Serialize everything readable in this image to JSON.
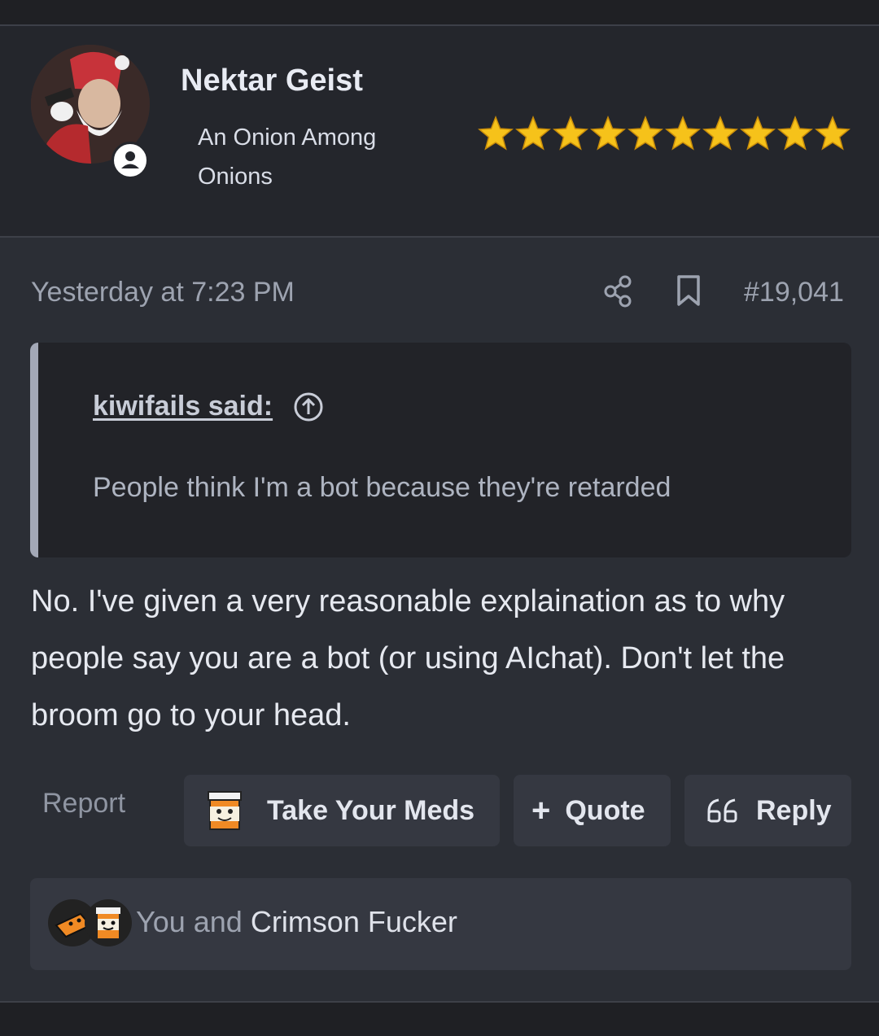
{
  "user": {
    "name": "Nektar Geist",
    "title": "An Onion Among Onions",
    "star_count": 10,
    "star_color": "#f6c21a"
  },
  "post": {
    "timestamp": "Yesterday at 7:23 PM",
    "number": "#19,041",
    "quote": {
      "author": "kiwifails said:",
      "text": "People think I'm a bot because they're retarded"
    },
    "message": "No. I've given a very reasonable explaination as to why people say you are a bot (or using AIchat). Don't let the broom go to your head."
  },
  "actions": {
    "report": "Report",
    "meds": "Take Your Meds",
    "quote": "Quote",
    "reply": "Reply"
  },
  "reactions": {
    "prefix": "You and ",
    "name": "Crimson Fucker"
  }
}
